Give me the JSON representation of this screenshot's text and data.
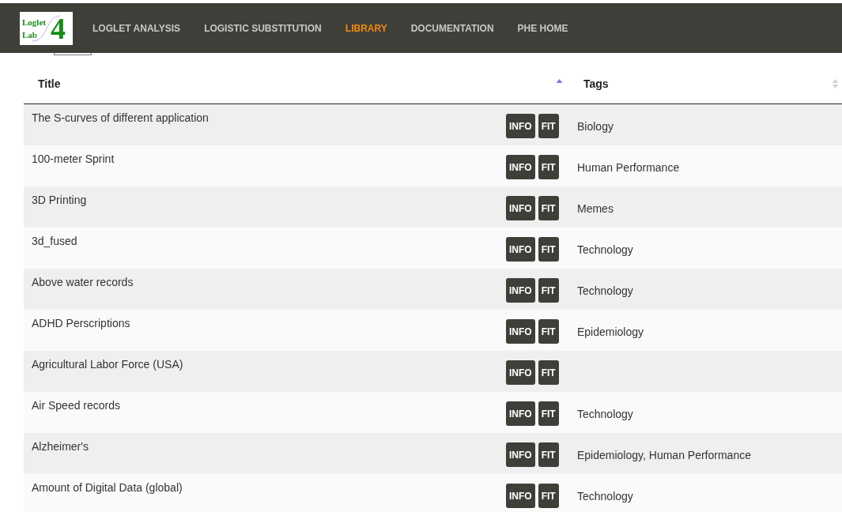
{
  "logo": {
    "line_1": "Loglet",
    "line_2": "Lab",
    "number": "4"
  },
  "nav": [
    {
      "label": "LOGLET ANALYSIS",
      "selected": false
    },
    {
      "label": "LOGISTIC SUBSTITUTION",
      "selected": false
    },
    {
      "label": "LIBRARY",
      "selected": true
    },
    {
      "label": "DOCUMENTATION",
      "selected": false
    },
    {
      "label": "PHE HOME",
      "selected": false
    }
  ],
  "table": {
    "columns": [
      {
        "label": "Title",
        "sorted": true
      },
      {
        "label": "Tags",
        "sorted": false
      }
    ],
    "rows": [
      {
        "title": "The S-curves of different application",
        "buttons": [
          "INFO",
          "FIT"
        ],
        "tags": "Biology"
      },
      {
        "title": "100-meter Sprint",
        "buttons": [
          "INFO",
          "FIT"
        ],
        "tags": "Human Performance"
      },
      {
        "title": "3D Printing",
        "buttons": [
          "INFO",
          "FIT"
        ],
        "tags": "Memes"
      },
      {
        "title": "3d_fused",
        "buttons": [
          "INFO",
          "FIT"
        ],
        "tags": "Technology"
      },
      {
        "title": "Above water records",
        "buttons": [
          "INFO",
          "FIT"
        ],
        "tags": "Technology"
      },
      {
        "title": "ADHD Perscriptions",
        "buttons": [
          "INFO",
          "FIT"
        ],
        "tags": "Epidemiology"
      },
      {
        "title": "Agricultural Labor Force (USA)",
        "buttons": [
          "INFO",
          "FIT"
        ]
      },
      {
        "title": "Air Speed records",
        "buttons": [
          "INFO",
          "FIT"
        ],
        "tags": "Technology"
      },
      {
        "title": "Alzheimer's",
        "buttons": [
          "INFO",
          "FIT"
        ],
        "tags": "Epidemiology, Human Performance"
      },
      {
        "title": "Amount of Digital Data (global)",
        "buttons": [
          "INFO",
          "FIT"
        ],
        "tags": "Technology"
      }
    ]
  }
}
